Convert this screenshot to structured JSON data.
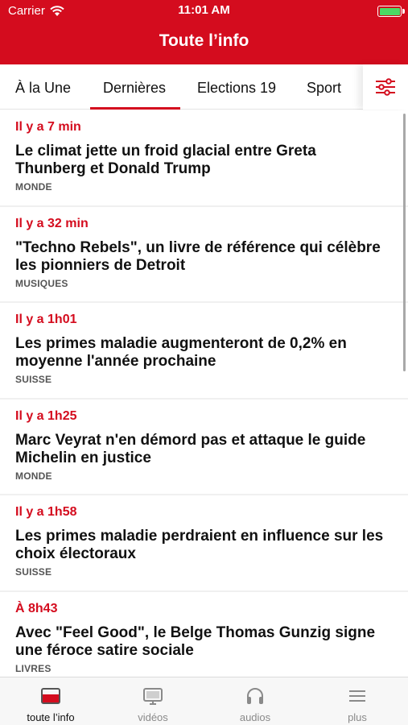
{
  "status_bar": {
    "carrier": "Carrier",
    "time": "11:01 AM"
  },
  "header": {
    "title": "Toute l’info",
    "background_color": "#d40c1e"
  },
  "tabs": [
    {
      "label": "À la Une",
      "active": false
    },
    {
      "label": "Dernières",
      "active": true
    },
    {
      "label": "Elections 19",
      "active": false
    },
    {
      "label": "Sport",
      "active": false
    }
  ],
  "filter_icon": "sliders-icon",
  "articles": [
    {
      "time": "Il y a 7 min",
      "title": "Le climat jette un froid glacial entre Greta Thunberg et Donald Trump",
      "category": "MONDE"
    },
    {
      "time": "Il y a 32 min",
      "title": "\"Techno Rebels\", un livre de référence qui célèbre les pionniers de Detroit",
      "category": "MUSIQUES"
    },
    {
      "time": "Il y a 1h01",
      "title": "Les primes maladie augmenteront de 0,2% en moyenne l'année prochaine",
      "category": "SUISSE"
    },
    {
      "time": "Il y a 1h25",
      "title": "Marc Veyrat n'en démord pas et attaque le guide Michelin en justice",
      "category": "MONDE"
    },
    {
      "time": "Il y a 1h58",
      "title": "Les primes maladie perdraient en influence sur les choix électoraux",
      "category": "SUISSE"
    },
    {
      "time": "À 8h43",
      "title": "Avec \"Feel Good\", le Belge Thomas Gunzig signe une féroce satire sociale",
      "category": "LIVRES"
    }
  ],
  "bottom_nav": [
    {
      "label": "toute l’info",
      "icon": "news-icon",
      "active": true
    },
    {
      "label": "vidéos",
      "icon": "tv-icon",
      "active": false
    },
    {
      "label": "audios",
      "icon": "headphones-icon",
      "active": false
    },
    {
      "label": "plus",
      "icon": "menu-icon",
      "active": false
    }
  ]
}
